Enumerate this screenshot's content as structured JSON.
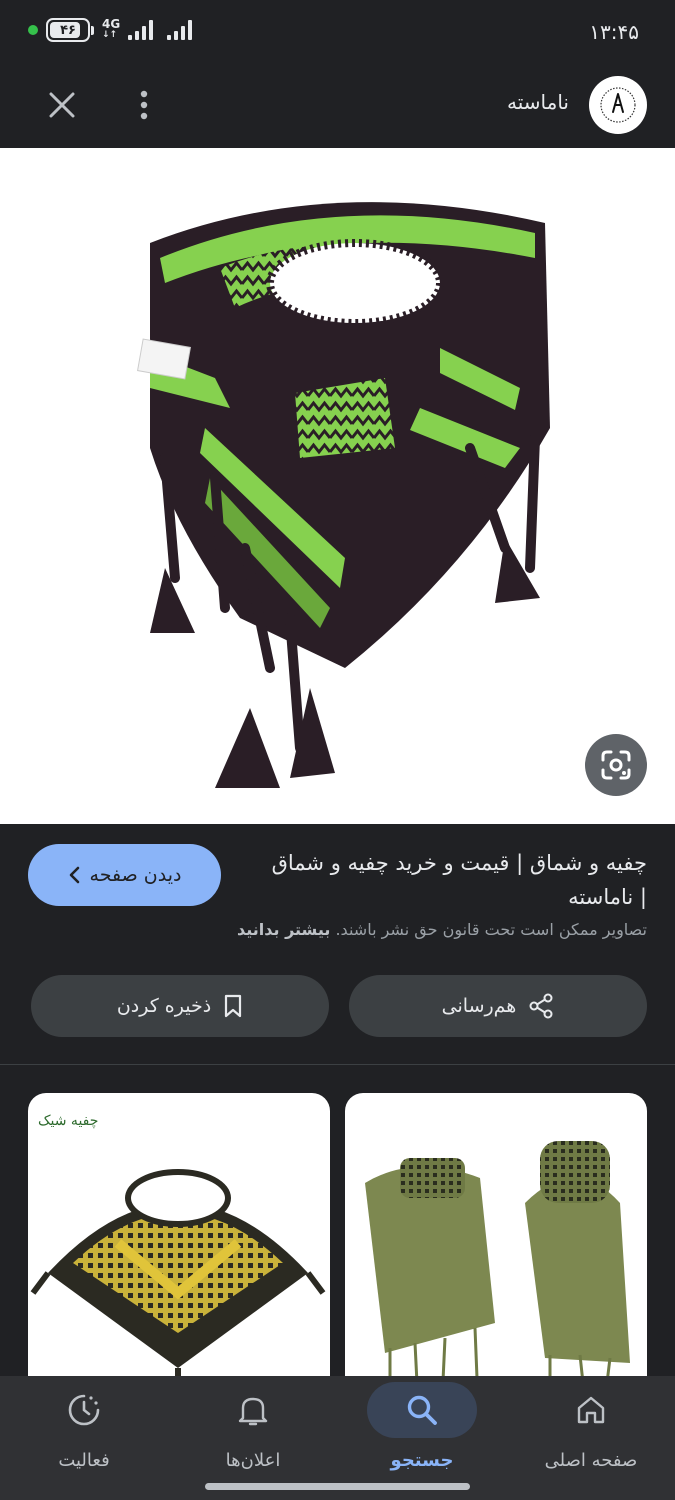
{
  "status_bar": {
    "time": "۱۳:۴۵",
    "battery": "۴۶",
    "network": "4G"
  },
  "header": {
    "site_name": "ناماسته"
  },
  "result": {
    "title": "چفیه و شماق | قیمت و خرید چفیه و شماق | ناماسته",
    "visit_label": "دیدن صفحه",
    "copyright_text": "تصاویر ممکن است تحت قانون حق نشر باشند.",
    "learn_more": "بیشتر بدانید",
    "share_label": "هم‌رسانی",
    "save_label": "ذخیره کردن"
  },
  "related": {
    "left_watermark": "چفیه شیک"
  },
  "bottom_nav": {
    "items": [
      {
        "label": "صفحه اصلی",
        "icon": "home-icon"
      },
      {
        "label": "جستجو",
        "icon": "search-icon",
        "active": true
      },
      {
        "label": "اعلان‌ها",
        "icon": "bell-icon"
      },
      {
        "label": "فعالیت",
        "icon": "activity-icon"
      }
    ]
  },
  "colors": {
    "background": "#202124",
    "accent": "#8ab4f8",
    "scarf_green": "#86d14f",
    "scarf_dark": "#2a1e26"
  }
}
